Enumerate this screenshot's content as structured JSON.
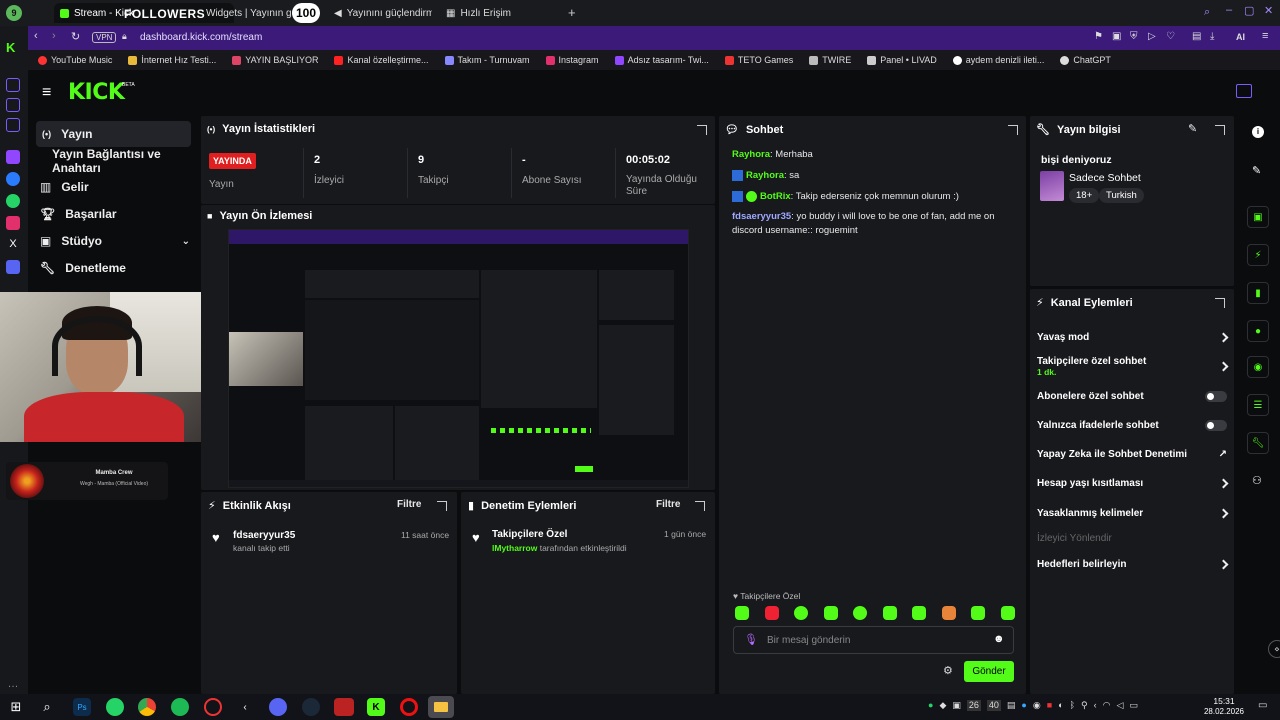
{
  "browser": {
    "tabs": [
      {
        "label": "Stream - Kick",
        "active": true
      },
      {
        "label": "Widgets | Yayının güçlendirm"
      },
      {
        "label": "Yayınını güçlendirmek"
      },
      {
        "label": "Hızlı Erişim"
      }
    ],
    "vpn": "VPN",
    "url": "dashboard.kick.com/stream",
    "ai": "AI",
    "bookmarks": [
      "YouTube Music",
      "İnternet Hız Testi...",
      "YAYIN BAŞLIYOR",
      "Kanal özelleştirme...",
      "Takım - Turnuvam",
      "Instagram",
      "Adsız tasarım- Twi...",
      "TETO Games",
      "TWIRE",
      "Panel • LIVAD",
      "aydem denizli ileti...",
      "ChatGPT"
    ]
  },
  "overlay": {
    "followers_label": "FOLLOWERS",
    "followers_count": "100",
    "now_playing_title": "Mamba Crew",
    "now_playing_sub": "Wegh - Mamba (Official Video)"
  },
  "kick": {
    "logo": "KICK",
    "beta": "BETA",
    "nav": [
      {
        "label": "Yayın"
      },
      {
        "label": "Yayın Bağlantısı ve Anahtarı"
      },
      {
        "label": "Gelir"
      },
      {
        "label": "Başarılar"
      },
      {
        "label": "Stüdyo"
      },
      {
        "label": "Denetleme"
      }
    ],
    "stats": {
      "title": "Yayın İstatistikleri",
      "live_badge": "YAYINDA",
      "live_label": "Yayın",
      "viewers": "2",
      "viewers_label": "İzleyici",
      "followers": "9",
      "followers_label": "Takipçi",
      "subs": "-",
      "subs_label": "Abone Sayısı",
      "uptime": "00:05:02",
      "uptime_label": "Yayında Olduğu Süre"
    },
    "preview_title": "Yayın Ön İzlemesi",
    "activity": {
      "title": "Etkinlik Akışı",
      "filter": "Filtre",
      "user": "fdsaeryyur35",
      "text": "kanalı takip etti",
      "time": "11 saat önce"
    },
    "moderation": {
      "title": "Denetim Eylemleri",
      "filter": "Filtre",
      "action": "Takipçilere Özel",
      "user": "lMytharrow",
      "text": "tarafından etkinleştirildi",
      "time": "1 gün önce"
    },
    "chat": {
      "title": "Sohbet",
      "messages": [
        {
          "user": "Rayhora",
          "text": "Merhaba",
          "color": "#53fc18"
        },
        {
          "user": "Rayhora",
          "text": "sa",
          "color": "#53fc18"
        },
        {
          "user": "BotRix",
          "text": "Takip ederseniz çok memnun olurum :)",
          "color": "#53fc18"
        },
        {
          "user": "fdsaeryyur35",
          "text": "yo buddy i will love to be one of fan, add me on discord username:: roguemint",
          "color": "#9fa9ff"
        }
      ],
      "mode": "Takipçilere Özel",
      "placeholder": "Bir mesaj gönderin",
      "send": "Gönder"
    },
    "info": {
      "title": "Yayın bilgisi",
      "stream_title": "bişi deniyoruz",
      "category": "Sadece Sohbet",
      "tag1": "18+",
      "tag2": "Turkish"
    },
    "actions": {
      "title": "Kanal Eylemleri",
      "slow": "Yavaş mod",
      "followers_only": "Takipçilere özel sohbet",
      "followers_only_sub": "1 dk.",
      "subs_only": "Abonelere özel sohbet",
      "emotes_only": "Yalnızca ifadelerle sohbet",
      "ai_mod": "Yapay Zeka ile Sohbet Denetimi",
      "age": "Hesap yaşı kısıtlaması",
      "banned": "Yasaklanmış kelimeler",
      "redirect": "İzleyici Yönlendir",
      "goals": "Hedefleri belirleyin"
    }
  },
  "taskbar": {
    "time": "15:31",
    "date": "28.02.2026"
  }
}
